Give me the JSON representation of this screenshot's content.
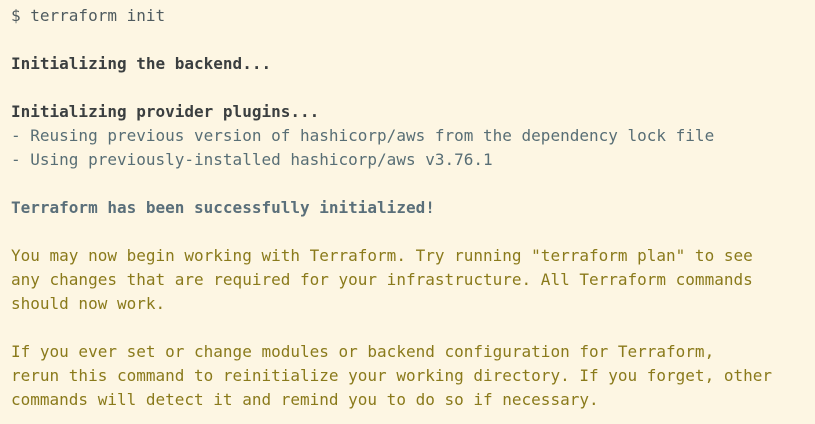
{
  "terminal": {
    "top_partial": "",
    "command": "$ terraform init",
    "backend_heading": "Initializing the backend...",
    "provider_heading": "Initializing provider plugins...",
    "provider_line_1": "- Reusing previous version of hashicorp/aws from the dependency lock file",
    "provider_line_2": "- Using previously-installed hashicorp/aws v3.76.1",
    "success_message": "Terraform has been successfully initialized!",
    "paragraph_1": [
      "You may now begin working with Terraform. Try running \"terraform plan\" to see",
      "any changes that are required for your infrastructure. All Terraform commands",
      "should now work."
    ],
    "paragraph_2": [
      "If you ever set or change modules or backend configuration for Terraform,",
      "rerun this command to reinitialize your working directory. If you forget, other",
      "commands will detect it and remind you to do so if necessary."
    ]
  }
}
